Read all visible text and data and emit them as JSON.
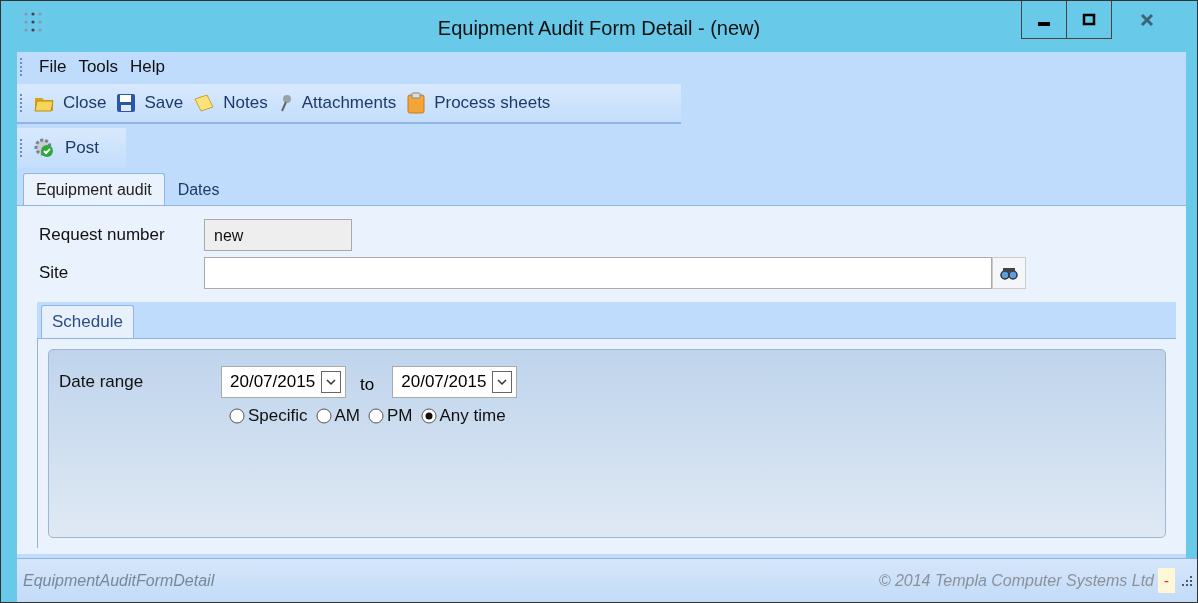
{
  "window": {
    "title": "Equipment Audit Form Detail - (new)"
  },
  "menu": [
    "File",
    "Tools",
    "Help"
  ],
  "toolbar": [
    {
      "label": "Close",
      "kind": "folder"
    },
    {
      "label": "Save",
      "kind": "disk"
    },
    {
      "label": "Notes",
      "kind": "note"
    },
    {
      "label": "Attachments",
      "kind": "pin"
    },
    {
      "label": "Process sheets",
      "kind": "clipboard"
    }
  ],
  "toolbar2": [
    {
      "label": "Post",
      "kind": "gear"
    }
  ],
  "tabs": [
    {
      "label": "Equipment audit",
      "selected": true
    },
    {
      "label": "Dates",
      "selected": false
    }
  ],
  "fields": {
    "request_number": {
      "label": "Request number",
      "value": "new"
    },
    "site": {
      "label": "Site"
    }
  },
  "schedule": {
    "tab": {
      "label": "Schedule",
      "selected": true
    },
    "date_range_label": "Date range",
    "from": "20/07/2015",
    "to_label": "to",
    "to": "20/07/2015",
    "options": [
      {
        "label": "Specific",
        "selected": false
      },
      {
        "label": "AM",
        "selected": false
      },
      {
        "label": "PM",
        "selected": false
      },
      {
        "label": "Any time",
        "selected": true
      }
    ]
  },
  "status_bar": {
    "form_name": "EquipmentAuditFormDetail",
    "copyright": "© 2014 Templa Computer Systems Ltd",
    "indicator": "-"
  }
}
